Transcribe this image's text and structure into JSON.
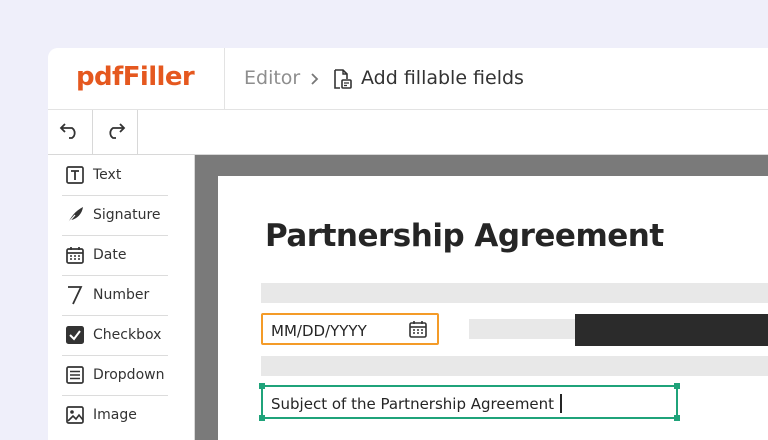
{
  "app": {
    "logo": "pdfFiller"
  },
  "breadcrumb": {
    "editor": "Editor",
    "page": "Add fillable fields"
  },
  "toolbar": {
    "undo_icon": "undo-icon",
    "redo_icon": "redo-icon"
  },
  "sidebar": {
    "items": [
      {
        "label": "Text",
        "icon": "text-box-icon"
      },
      {
        "label": "Signature",
        "icon": "feather-pen-icon"
      },
      {
        "label": "Date",
        "icon": "calendar-icon"
      },
      {
        "label": "Number",
        "icon": "number-seven-icon"
      },
      {
        "label": "Checkbox",
        "icon": "checkbox-icon"
      },
      {
        "label": "Dropdown",
        "icon": "dropdown-icon"
      },
      {
        "label": "Image",
        "icon": "image-icon"
      }
    ]
  },
  "document": {
    "title": "Partnership Agreement",
    "date_field": {
      "placeholder": "MM/DD/YYYY",
      "icon": "calendar-icon"
    },
    "subject_field": {
      "value": "Subject of the Partnership Agreement"
    }
  },
  "colors": {
    "brand": "#e5581f",
    "date_field_border": "#f49b28",
    "active_field_border": "#1fa37a",
    "canvas": "#7a7a7a",
    "background": "#efeffa"
  }
}
